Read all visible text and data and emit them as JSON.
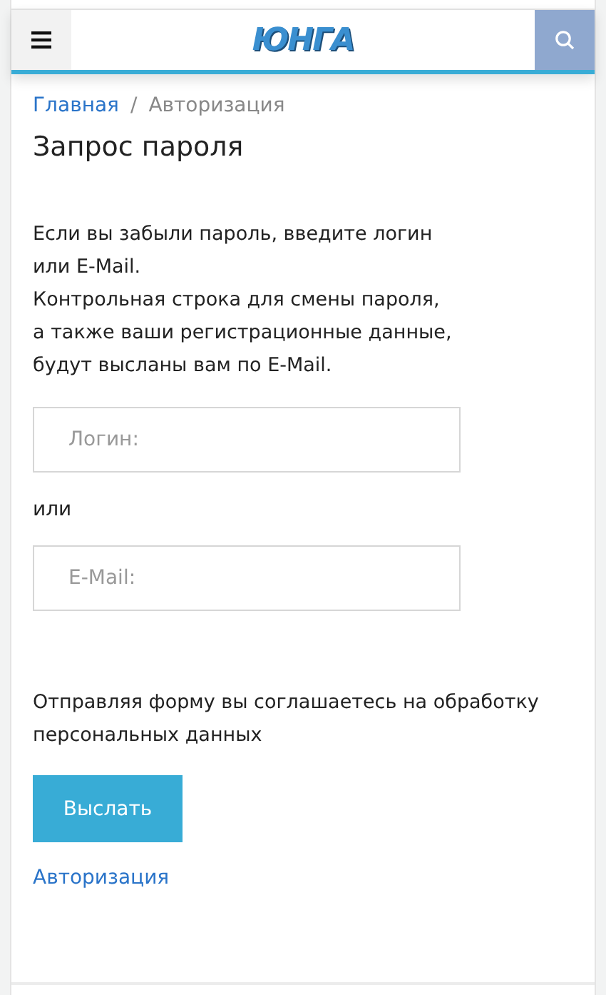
{
  "header": {
    "logo": "ЮНГА"
  },
  "breadcrumbs": [
    {
      "label": "Главная",
      "kind": "link"
    },
    {
      "label": "Авторизация",
      "kind": "current"
    }
  ],
  "breadcrumb_separator": "/",
  "title": "Запрос пароля",
  "intro": "Если вы забыли пароль, введите логин\nили E-Mail.\nКонтрольная строка для смены пароля,\nа также ваши регистрационные данные,\nбудут высланы вам по E-Mail.",
  "login_field": {
    "placeholder": "Логин:"
  },
  "or_text": "или",
  "email_field": {
    "placeholder": "E-Mail:"
  },
  "consent": "Отправляя форму вы соглашаетесь на обработку персональных данных",
  "submit_button": "Выслать",
  "auth_link": "Авторизация"
}
